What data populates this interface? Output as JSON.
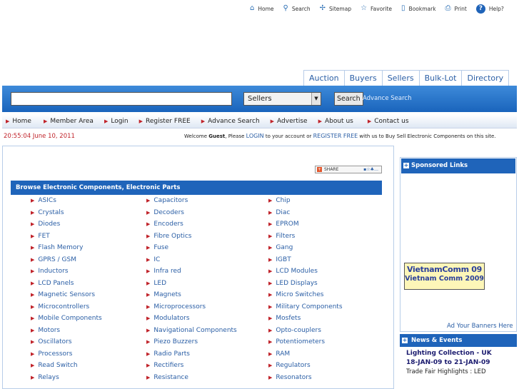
{
  "top_links": [
    {
      "label": "Home",
      "icon": "home-icon"
    },
    {
      "label": "Search",
      "icon": "search-icon"
    },
    {
      "label": "Sitemap",
      "icon": "sitemap-icon"
    },
    {
      "label": "Favorite",
      "icon": "star-icon"
    },
    {
      "label": "Bookmark",
      "icon": "bookmark-icon"
    },
    {
      "label": "Print",
      "icon": "print-icon"
    },
    {
      "label": "Help?",
      "icon": "help-icon"
    }
  ],
  "tabs": [
    "Auction",
    "Buyers",
    "Sellers",
    "Bulk-Lot",
    "Directory"
  ],
  "search": {
    "input_value": "",
    "category_value": "Sellers",
    "button_label": "Search",
    "advance_label": "Advance Search"
  },
  "nav": [
    "Home",
    "Member Area",
    "Login",
    "Register FREE",
    "Advance Search",
    "Advertise",
    "About us",
    "Contact us"
  ],
  "datetime": "20:55:04 June 10, 2011",
  "welcome": {
    "prefix": "Welcome ",
    "user": "Guest",
    "mid1": ", Please ",
    "login": "LOGIN",
    "mid2": " to your account or ",
    "register": "REGISTER FREE",
    "suffix": " with us to Buy Sell Electronic Components on this site."
  },
  "share_label": "SHARE",
  "browse_title": "Browse Electronic Components, Electronic Parts",
  "categories": {
    "col1": [
      "ASICs",
      "Crystals",
      "Diodes",
      "FET",
      "Flash Memory",
      "GPRS / GSM",
      "Inductors",
      "LCD Panels",
      "Magnetic Sensors",
      "Microcontrollers",
      "Mobile Components",
      "Motors",
      "Oscillators",
      "Processors",
      "Read Switch",
      "Relays"
    ],
    "col2": [
      "Capacitors",
      "Decoders",
      "Encoders",
      "Fibre Optics",
      "Fuse",
      "IC",
      "Infra red",
      "LED",
      "Magnets",
      "Microprocessors",
      "Modulators",
      "Navigational Components",
      "Piezo Buzzers",
      "Radio Parts",
      "Rectifiers",
      "Resistance"
    ],
    "col3": [
      "Chip",
      "Diac",
      "EPROM",
      "Filters",
      "Gang",
      "IGBT",
      "LCD Modules",
      "LED Displays",
      "Micro Switches",
      "Military Components",
      "Mosfets",
      "Opto-couplers",
      "Potentiometers",
      "RAM",
      "Regulators",
      "Resonators"
    ]
  },
  "sponsored": {
    "title": "Sponsored Links",
    "banner_line1": "VietnamComm 09",
    "banner_line2": "Vietnam Comm 2009",
    "banner_link": "Ad Your Banners Here"
  },
  "news": {
    "title": "News & Events",
    "item_title": "Lighting Collection - UK",
    "item_dates": "18-JAN-09 to 21-JAN-09",
    "item_highlight": "Trade Fair Highlights : LED"
  },
  "colors": {
    "accent_blue": "#1f64ba",
    "link_blue": "#2a5ea5",
    "bullet_red": "#c0232a"
  }
}
